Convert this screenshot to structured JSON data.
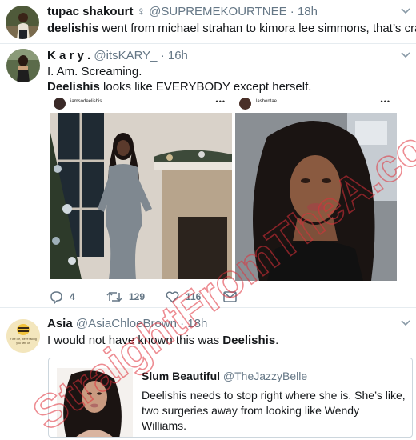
{
  "tweets": [
    {
      "display_name": "tupac shakourt",
      "name_symbol": "♀",
      "handle": "@SUPREMEKOURTNEE",
      "separator": "·",
      "time": "18h",
      "text_bold": "deelishis",
      "text_rest": " went from michael strahan to kimora lee simmons, that’s crazy."
    },
    {
      "display_name": "K a r y .",
      "handle": "@itsKARY_",
      "separator": "·",
      "time": "16h",
      "line1": "I. Am. Screaming.",
      "line2_bold": "Deelishis",
      "line2_rest": " looks like EVERYBODY except herself.",
      "instagram_cards": [
        {
          "username": "iamsodeelishis",
          "more": "•••"
        },
        {
          "username": "lashontae",
          "more": "•••"
        }
      ],
      "actions": {
        "reply_count": "4",
        "retweet_count": "129",
        "like_count": "116"
      }
    },
    {
      "display_name": "Asia",
      "handle": "@AsiaChloeBrown",
      "separator": "·",
      "time": "18h",
      "text_plain": "I would not have known this was ",
      "text_bold": "Deelishis",
      "text_end": ".",
      "avatar_caption": "If we die, we're taking you with us",
      "quoted": {
        "display_name": "Slum Beautiful",
        "handle": "@TheJazzyBelle",
        "text": "Deelishis needs to stop right where she is. She’s like, two surgeries away from looking like Wendy Williams."
      }
    }
  ],
  "watermark": "StraightFromTheA.com",
  "colors": {
    "text": "#14171a",
    "muted": "#657786",
    "border": "#e6ecf0",
    "watermark": "#e0303a"
  }
}
